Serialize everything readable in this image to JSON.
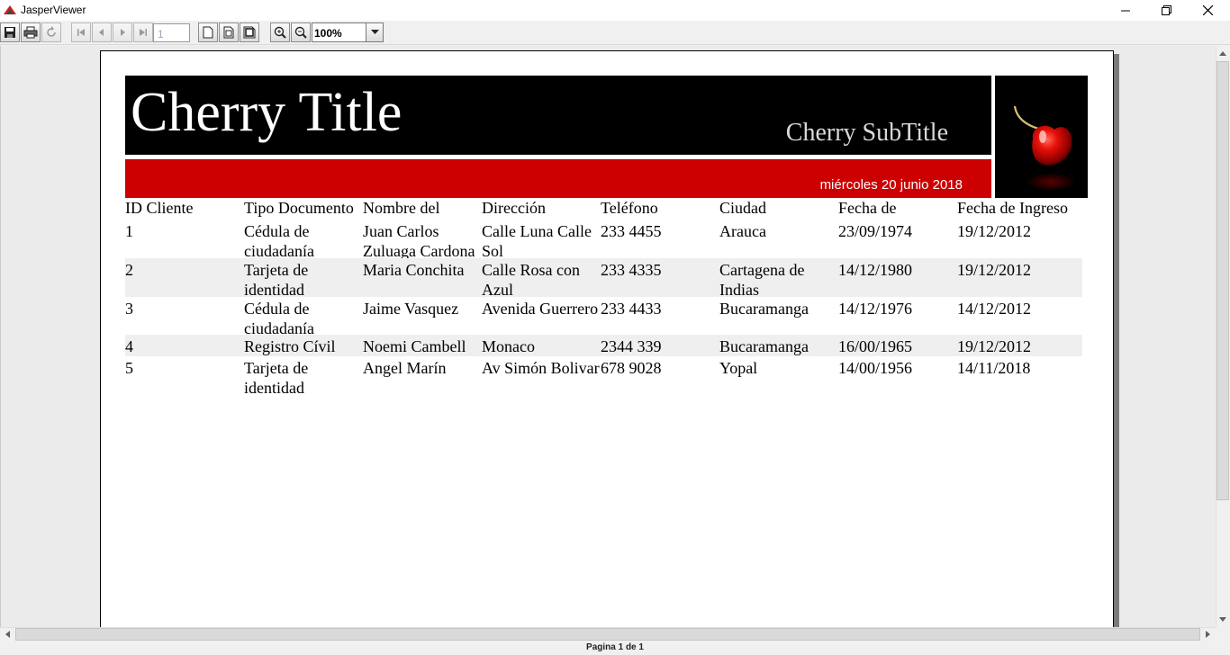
{
  "window": {
    "title": "JasperViewer",
    "accent": "#cc0000"
  },
  "toolbar": {
    "buttons": [
      {
        "name": "save-icon"
      },
      {
        "name": "print-icon"
      },
      {
        "name": "reload-icon"
      },
      {
        "name": "first-page-icon"
      },
      {
        "name": "previous-page-icon"
      },
      {
        "name": "next-page-icon"
      },
      {
        "name": "last-page-icon"
      },
      {
        "name": "actual-size-icon"
      },
      {
        "name": "fit-page-icon"
      },
      {
        "name": "fit-width-icon"
      },
      {
        "name": "zoom-in-icon"
      },
      {
        "name": "zoom-out-icon"
      }
    ],
    "page_number": "1",
    "zoom_value": "100%"
  },
  "report": {
    "title": "Cherry Title",
    "subtitle": "Cherry SubTitle",
    "date": "miércoles 20 junio 2018",
    "columns": [
      "ID Cliente",
      "Tipo Documento",
      "Nombre del",
      "Dirección",
      "Teléfono",
      "Ciudad",
      "Fecha de",
      "Fecha de Ingreso"
    ],
    "rows": [
      [
        "1",
        "Cédula de ciudadanía",
        "Juan Carlos Zuluaga Cardona",
        "Calle Luna Calle Sol",
        "233 4455",
        "Arauca",
        "23/09/1974",
        "19/12/2012"
      ],
      [
        "2",
        "Tarjeta de identidad",
        "Maria Conchita",
        "Calle Rosa con Azul",
        "233 4335",
        "Cartagena de Indias",
        "14/12/1980",
        "19/12/2012"
      ],
      [
        "3",
        "Cédula de ciudadanía",
        "Jaime Vasquez",
        "Avenida Guerrero",
        "233 4433",
        "Bucaramanga",
        "14/12/1976",
        "14/12/2012"
      ],
      [
        "4",
        "Registro Cívil",
        "Noemi Cambell",
        "Monaco",
        "2344 339",
        "Bucaramanga",
        "16/00/1965",
        "19/12/2012"
      ],
      [
        "5",
        "Tarjeta de identidad",
        "Angel Marín",
        "Av Simón Bolivar",
        "678 9028",
        "Yopal",
        "14/00/1956",
        "14/11/2018"
      ]
    ]
  },
  "status": {
    "page_label": "Pagina 1 de 1"
  }
}
